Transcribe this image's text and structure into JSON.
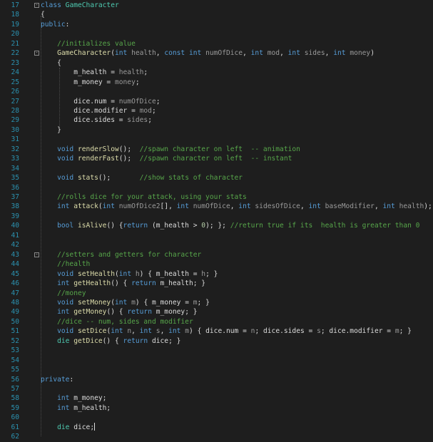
{
  "editor": {
    "lines": [
      {
        "n": "17",
        "fold": "-",
        "t": [
          [
            "kw",
            "class"
          ],
          [
            "df",
            " "
          ],
          [
            "ty",
            "GameCharacter"
          ]
        ]
      },
      {
        "n": "18",
        "t": [
          [
            "df",
            "{"
          ]
        ]
      },
      {
        "n": "19",
        "t": [
          [
            "kw",
            "public"
          ],
          [
            "df",
            ":"
          ]
        ]
      },
      {
        "n": "20",
        "t": []
      },
      {
        "n": "21",
        "t": [
          [
            "df",
            "    "
          ],
          [
            "cm",
            "//initializes value"
          ]
        ]
      },
      {
        "n": "22",
        "fold": "-",
        "t": [
          [
            "df",
            "    "
          ],
          [
            "fn",
            "GameCharacter"
          ],
          [
            "df",
            "("
          ],
          [
            "kw",
            "int"
          ],
          [
            "df",
            " "
          ],
          [
            "pa",
            "health"
          ],
          [
            "df",
            ", "
          ],
          [
            "kw",
            "const"
          ],
          [
            "df",
            " "
          ],
          [
            "kw",
            "int"
          ],
          [
            "df",
            " "
          ],
          [
            "pa",
            "numOfDice"
          ],
          [
            "df",
            ", "
          ],
          [
            "kw",
            "int"
          ],
          [
            "df",
            " "
          ],
          [
            "pa",
            "mod"
          ],
          [
            "df",
            ", "
          ],
          [
            "kw",
            "int"
          ],
          [
            "df",
            " "
          ],
          [
            "pa",
            "sides"
          ],
          [
            "df",
            ", "
          ],
          [
            "kw",
            "int"
          ],
          [
            "df",
            " "
          ],
          [
            "pa",
            "money"
          ],
          [
            "df",
            ")"
          ]
        ]
      },
      {
        "n": "23",
        "t": [
          [
            "df",
            "    {"
          ]
        ]
      },
      {
        "n": "24",
        "t": [
          [
            "df",
            "        m_health = "
          ],
          [
            "pa",
            "health"
          ],
          [
            "df",
            ";"
          ]
        ]
      },
      {
        "n": "25",
        "t": [
          [
            "df",
            "        m_money = "
          ],
          [
            "pa",
            "money"
          ],
          [
            "df",
            ";"
          ]
        ]
      },
      {
        "n": "26",
        "t": []
      },
      {
        "n": "27",
        "t": [
          [
            "df",
            "        dice.num = "
          ],
          [
            "pa",
            "numOfDice"
          ],
          [
            "df",
            ";"
          ]
        ]
      },
      {
        "n": "28",
        "t": [
          [
            "df",
            "        dice.modifier = "
          ],
          [
            "pa",
            "mod"
          ],
          [
            "df",
            ";"
          ]
        ]
      },
      {
        "n": "29",
        "t": [
          [
            "df",
            "        dice.sides = "
          ],
          [
            "pa",
            "sides"
          ],
          [
            "df",
            ";"
          ]
        ]
      },
      {
        "n": "30",
        "t": [
          [
            "df",
            "    }"
          ]
        ]
      },
      {
        "n": "31",
        "t": []
      },
      {
        "n": "32",
        "t": [
          [
            "df",
            "    "
          ],
          [
            "kw",
            "void"
          ],
          [
            "df",
            " "
          ],
          [
            "fn",
            "renderSlow"
          ],
          [
            "df",
            "();  "
          ],
          [
            "cm",
            "//spawn character on left  -- animation"
          ]
        ]
      },
      {
        "n": "33",
        "t": [
          [
            "df",
            "    "
          ],
          [
            "kw",
            "void"
          ],
          [
            "df",
            " "
          ],
          [
            "fn",
            "renderFast"
          ],
          [
            "df",
            "();  "
          ],
          [
            "cm",
            "//spawn character on left  -- instant"
          ]
        ]
      },
      {
        "n": "34",
        "t": []
      },
      {
        "n": "35",
        "t": [
          [
            "df",
            "    "
          ],
          [
            "kw",
            "void"
          ],
          [
            "df",
            " "
          ],
          [
            "fn",
            "stats"
          ],
          [
            "df",
            "();       "
          ],
          [
            "cm",
            "//show stats of character"
          ]
        ]
      },
      {
        "n": "36",
        "t": []
      },
      {
        "n": "37",
        "t": [
          [
            "df",
            "    "
          ],
          [
            "cm",
            "//rolls dice for your attack, using your stats"
          ]
        ]
      },
      {
        "n": "38",
        "t": [
          [
            "df",
            "    "
          ],
          [
            "kw",
            "int"
          ],
          [
            "df",
            " "
          ],
          [
            "fn",
            "attack"
          ],
          [
            "df",
            "("
          ],
          [
            "kw",
            "int"
          ],
          [
            "df",
            " "
          ],
          [
            "pa",
            "numOfDice2"
          ],
          [
            "df",
            "[], "
          ],
          [
            "kw",
            "int"
          ],
          [
            "df",
            " "
          ],
          [
            "pa",
            "numOfDice"
          ],
          [
            "df",
            ", "
          ],
          [
            "kw",
            "int"
          ],
          [
            "df",
            " "
          ],
          [
            "pa",
            "sidesOfDice"
          ],
          [
            "df",
            ", "
          ],
          [
            "kw",
            "int"
          ],
          [
            "df",
            " "
          ],
          [
            "pa",
            "baseModifier"
          ],
          [
            "df",
            ", "
          ],
          [
            "kw",
            "int"
          ],
          [
            "df",
            " "
          ],
          [
            "pa",
            "health"
          ],
          [
            "df",
            ");"
          ]
        ]
      },
      {
        "n": "39",
        "t": []
      },
      {
        "n": "40",
        "t": [
          [
            "df",
            "    "
          ],
          [
            "kw",
            "bool"
          ],
          [
            "df",
            " "
          ],
          [
            "fn",
            "isAlive"
          ],
          [
            "df",
            "() {"
          ],
          [
            "kw",
            "return"
          ],
          [
            "df",
            " (m_health > "
          ],
          [
            "nm",
            "0"
          ],
          [
            "df",
            "); }; "
          ],
          [
            "cm",
            "//return true if its  health is greater than 0"
          ]
        ]
      },
      {
        "n": "41",
        "t": []
      },
      {
        "n": "42",
        "t": []
      },
      {
        "n": "43",
        "fold": "-",
        "t": [
          [
            "df",
            "    "
          ],
          [
            "cm",
            "//setters and getters for character"
          ]
        ]
      },
      {
        "n": "44",
        "t": [
          [
            "df",
            "    "
          ],
          [
            "cm",
            "//health"
          ]
        ]
      },
      {
        "n": "45",
        "t": [
          [
            "df",
            "    "
          ],
          [
            "kw",
            "void"
          ],
          [
            "df",
            " "
          ],
          [
            "fn",
            "setHealth"
          ],
          [
            "df",
            "("
          ],
          [
            "kw",
            "int"
          ],
          [
            "df",
            " "
          ],
          [
            "pa",
            "h"
          ],
          [
            "df",
            ") { m_health = "
          ],
          [
            "pa",
            "h"
          ],
          [
            "df",
            "; }"
          ]
        ]
      },
      {
        "n": "46",
        "t": [
          [
            "df",
            "    "
          ],
          [
            "kw",
            "int"
          ],
          [
            "df",
            " "
          ],
          [
            "fn",
            "getHealth"
          ],
          [
            "df",
            "() { "
          ],
          [
            "kw",
            "return"
          ],
          [
            "df",
            " m_health; }"
          ]
        ]
      },
      {
        "n": "47",
        "t": [
          [
            "df",
            "    "
          ],
          [
            "cm",
            "//money"
          ]
        ]
      },
      {
        "n": "48",
        "t": [
          [
            "df",
            "    "
          ],
          [
            "kw",
            "void"
          ],
          [
            "df",
            " "
          ],
          [
            "fn",
            "setMoney"
          ],
          [
            "df",
            "("
          ],
          [
            "kw",
            "int"
          ],
          [
            "df",
            " "
          ],
          [
            "pa",
            "m"
          ],
          [
            "df",
            ") { m_money = "
          ],
          [
            "pa",
            "m"
          ],
          [
            "df",
            "; }"
          ]
        ]
      },
      {
        "n": "49",
        "t": [
          [
            "df",
            "    "
          ],
          [
            "kw",
            "int"
          ],
          [
            "df",
            " "
          ],
          [
            "fn",
            "getMoney"
          ],
          [
            "df",
            "() { "
          ],
          [
            "kw",
            "return"
          ],
          [
            "df",
            " m_money; }"
          ]
        ]
      },
      {
        "n": "50",
        "t": [
          [
            "df",
            "    "
          ],
          [
            "cm",
            "//dice -- num, sides and modifier"
          ]
        ]
      },
      {
        "n": "51",
        "t": [
          [
            "df",
            "    "
          ],
          [
            "kw",
            "void"
          ],
          [
            "df",
            " "
          ],
          [
            "fn",
            "setDice"
          ],
          [
            "df",
            "("
          ],
          [
            "kw",
            "int"
          ],
          [
            "df",
            " "
          ],
          [
            "pa",
            "n"
          ],
          [
            "df",
            ", "
          ],
          [
            "kw",
            "int"
          ],
          [
            "df",
            " "
          ],
          [
            "pa",
            "s"
          ],
          [
            "df",
            ", "
          ],
          [
            "kw",
            "int"
          ],
          [
            "df",
            " "
          ],
          [
            "pa",
            "m"
          ],
          [
            "df",
            ") { dice.num = "
          ],
          [
            "pa",
            "n"
          ],
          [
            "df",
            "; dice.sides = "
          ],
          [
            "pa",
            "s"
          ],
          [
            "df",
            "; dice.modifier = "
          ],
          [
            "pa",
            "m"
          ],
          [
            "df",
            "; }"
          ]
        ]
      },
      {
        "n": "52",
        "t": [
          [
            "df",
            "    "
          ],
          [
            "ty",
            "die"
          ],
          [
            "df",
            " "
          ],
          [
            "fn",
            "getDice"
          ],
          [
            "df",
            "() { "
          ],
          [
            "kw",
            "return"
          ],
          [
            "df",
            " dice; }"
          ]
        ]
      },
      {
        "n": "53",
        "t": []
      },
      {
        "n": "54",
        "t": []
      },
      {
        "n": "55",
        "t": []
      },
      {
        "n": "56",
        "t": [
          [
            "kw",
            "private"
          ],
          [
            "df",
            ":"
          ]
        ]
      },
      {
        "n": "57",
        "t": []
      },
      {
        "n": "58",
        "t": [
          [
            "df",
            "    "
          ],
          [
            "kw",
            "int"
          ],
          [
            "df",
            " m_money;"
          ]
        ]
      },
      {
        "n": "59",
        "t": [
          [
            "df",
            "    "
          ],
          [
            "kw",
            "int"
          ],
          [
            "df",
            " m_health;"
          ]
        ]
      },
      {
        "n": "60",
        "t": []
      },
      {
        "n": "61",
        "cursor": true,
        "t": [
          [
            "df",
            "    "
          ],
          [
            "ty",
            "die"
          ],
          [
            "df",
            " dice;"
          ]
        ]
      },
      {
        "n": "62",
        "t": []
      }
    ]
  }
}
